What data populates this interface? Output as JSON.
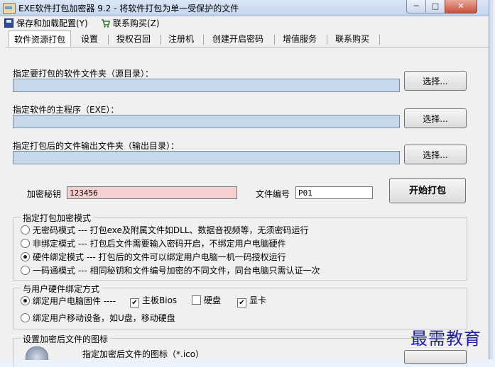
{
  "window": {
    "title": "EXE软件打包加密器 9.2 - 将软件打包为单一受保护的文件",
    "min_label": "─",
    "max_label": "□",
    "close_label": "✕"
  },
  "menu": {
    "save_load": "保存和加载配置(Y)",
    "contact_buy": "联系购买(Z)"
  },
  "tabs": [
    "软件资源打包",
    "设置",
    "授权召回",
    "注册机",
    "创建开启密码",
    "增值服务",
    "联系购买"
  ],
  "active_tab": "软件资源打包",
  "source": {
    "label": "指定要打包的软件文件夹（源目录）：",
    "value": "",
    "button": "选择..."
  },
  "main_exe": {
    "label": "指定软件的主程序（EXE）：",
    "value": "",
    "button": "选择..."
  },
  "output": {
    "label": "指定打包后的文件输出文件夹（输出目录）：",
    "value": "",
    "button": "选择..."
  },
  "encrypt_key": {
    "label": "加密秘钥",
    "value": "123456"
  },
  "file_number": {
    "label": "文件编号",
    "value": "P01"
  },
  "pack_button": "开始打包",
  "mode_group": {
    "title": "指定打包加密模式",
    "options": [
      {
        "label": "无密码模式 --- 打包exe及附属文件如DLL、数据音视频等，无须密码运行",
        "selected": false
      },
      {
        "label": "非绑定模式 --- 打包后文件需要输入密码开启，不绑定用户电脑硬件",
        "selected": false
      },
      {
        "label": "硬件绑定模式 --- 打包后的文件可以绑定用户电脑一机一码授权运行",
        "selected": true
      },
      {
        "label": "一码通模式 --- 相同秘钥和文件编号加密的不同文件，同台电脑只需认证一次",
        "selected": false
      }
    ]
  },
  "bind_group": {
    "title": "与用户硬件绑定方式",
    "option_pc": {
      "label": "绑定用户电脑固件 ----",
      "selected": true
    },
    "checks": [
      {
        "label": "主板Bios",
        "checked": true
      },
      {
        "label": "硬盘",
        "checked": false
      },
      {
        "label": "显卡",
        "checked": true
      }
    ],
    "option_mobile": {
      "label": "绑定用户移动设备，如U盘，移动硬盘",
      "selected": false
    }
  },
  "icon_group": {
    "title": "设置加密后文件的图标",
    "label": "指定加密后文件的图标（*.ico）"
  },
  "watermark": "最需教育"
}
